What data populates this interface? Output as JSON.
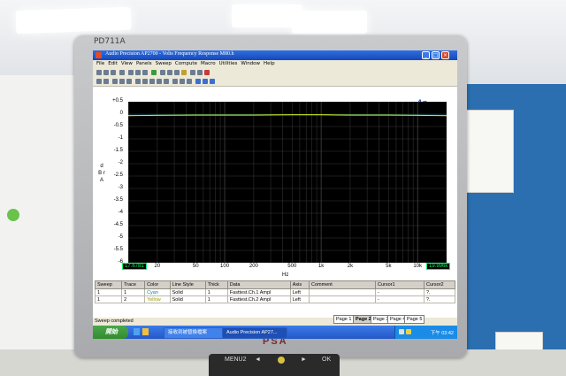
{
  "monitor": {
    "model": "PD711A",
    "brand": "PSA",
    "buttons": [
      "MENU2",
      "◄",
      "►",
      "OK"
    ]
  },
  "window": {
    "title": "Audio Precision AP2700 - Volts Frequency Response M80.h"
  },
  "menu": [
    "File",
    "Edit",
    "View",
    "Panels",
    "Sweep",
    "Compute",
    "Macro",
    "Utilities",
    "Window",
    "Help"
  ],
  "chart_data": {
    "type": "line",
    "title": "",
    "xlabel": "Hz",
    "ylabel": "d B r A",
    "xscale": "log",
    "xlim": [
      10,
      20000
    ],
    "ylim": [
      -6,
      0.5
    ],
    "grid": true,
    "x_ticks": [
      "20",
      "50",
      "100",
      "200",
      "500",
      "1k",
      "2k",
      "5k",
      "10k"
    ],
    "y_ticks": [
      "+0.5",
      "0",
      "-0.5",
      "-1",
      "-1.5",
      "-2",
      "-2.5",
      "-3",
      "-3.5",
      "-4",
      "-4.5",
      "-5",
      "-5.5",
      "-6"
    ],
    "series": [
      {
        "name": "Cyan",
        "color": "#00e5ff",
        "x": [
          10,
          20,
          50,
          100,
          200,
          500,
          1000,
          2000,
          5000,
          10000,
          20000
        ],
        "y": [
          -0.05,
          -0.04,
          -0.03,
          -0.03,
          -0.03,
          -0.02,
          -0.02,
          -0.03,
          -0.03,
          -0.04,
          -0.05
        ]
      },
      {
        "name": "Yellow",
        "color": "#f0f000",
        "x": [
          10,
          20,
          50,
          100,
          200,
          500,
          1000,
          2000,
          5000,
          10000,
          20000
        ],
        "y": [
          -0.06,
          -0.05,
          -0.04,
          -0.04,
          -0.04,
          -0.03,
          -0.03,
          -0.04,
          -0.04,
          -0.05,
          -0.06
        ]
      }
    ],
    "cursor_left": "17.6781",
    "cursor_right": "19.996k"
  },
  "ap_logo": "Ap",
  "table": {
    "headers": [
      "Sweep",
      "Trace",
      "Color",
      "Line Style",
      "Thick",
      "Data",
      "Axis",
      "Comment",
      "Cursor1",
      "Cursor2"
    ],
    "rows": [
      [
        "1",
        "1",
        "Cyan",
        "Solid",
        "1",
        "Fasttest.Ch.1 Ampl",
        "Left",
        "",
        "-",
        "?."
      ],
      [
        "1",
        "2",
        "Yellow",
        "Solid",
        "1",
        "Fasttest.Ch.2 Ampl",
        "Left",
        "",
        "-",
        "?."
      ]
    ]
  },
  "status": "Sweep completed",
  "pages": [
    "Page 1",
    "Page 2",
    "Page 3",
    "Page 4",
    "Page 5"
  ],
  "taskbar": {
    "start": "開始",
    "items": [
      "接收到被替換檔案",
      "Audio Precision AP27..."
    ],
    "clock": "下午 03:42"
  },
  "colors": {
    "plot_bg": "#000000",
    "grid": "#4a4a4a",
    "trace": "#e8e800",
    "taskbar": "#2a5fd0",
    "titlebar": "#1f55c9"
  }
}
